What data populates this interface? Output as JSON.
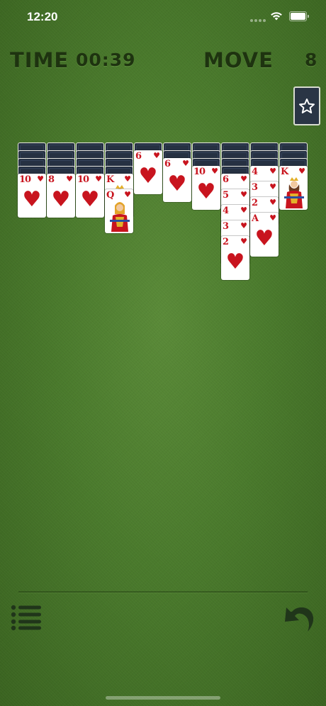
{
  "status_bar": {
    "time": "12:20"
  },
  "hud": {
    "time_label": "TIME",
    "time_value": "00:39",
    "move_label": "MOVE",
    "move_value": "8"
  },
  "colors": {
    "felt": "#4a7a2c",
    "card_back": "#263142",
    "red": "#c8141e",
    "hud_text": "#1e3310"
  },
  "icons": {
    "hint": "star-icon",
    "menu": "list-menu-icon",
    "undo": "undo-arrow-icon"
  },
  "tableau": [
    {
      "hidden": 4,
      "cards": [
        {
          "rank": "10",
          "suit": "♥"
        }
      ]
    },
    {
      "hidden": 4,
      "cards": [
        {
          "rank": "8",
          "suit": "♥"
        }
      ]
    },
    {
      "hidden": 4,
      "cards": [
        {
          "rank": "10",
          "suit": "♥"
        }
      ]
    },
    {
      "hidden": 4,
      "cards": [
        {
          "rank": "K",
          "suit": "♥"
        },
        {
          "rank": "Q",
          "suit": "♥"
        }
      ]
    },
    {
      "hidden": 1,
      "cards": [
        {
          "rank": "6",
          "suit": "♥"
        }
      ]
    },
    {
      "hidden": 2,
      "cards": [
        {
          "rank": "6",
          "suit": "♥"
        }
      ]
    },
    {
      "hidden": 3,
      "cards": [
        {
          "rank": "10",
          "suit": "♥"
        }
      ]
    },
    {
      "hidden": 4,
      "cards": [
        {
          "rank": "6",
          "suit": "♥"
        },
        {
          "rank": "5",
          "suit": "♥"
        },
        {
          "rank": "4",
          "suit": "♥"
        },
        {
          "rank": "3",
          "suit": "♥"
        },
        {
          "rank": "2",
          "suit": "♥"
        }
      ]
    },
    {
      "hidden": 3,
      "cards": [
        {
          "rank": "4",
          "suit": "♥"
        },
        {
          "rank": "3",
          "suit": "♥"
        },
        {
          "rank": "2",
          "suit": "♥"
        },
        {
          "rank": "A",
          "suit": "♥"
        }
      ]
    },
    {
      "hidden": 3,
      "cards": [
        {
          "rank": "K",
          "suit": "♥"
        }
      ]
    }
  ]
}
